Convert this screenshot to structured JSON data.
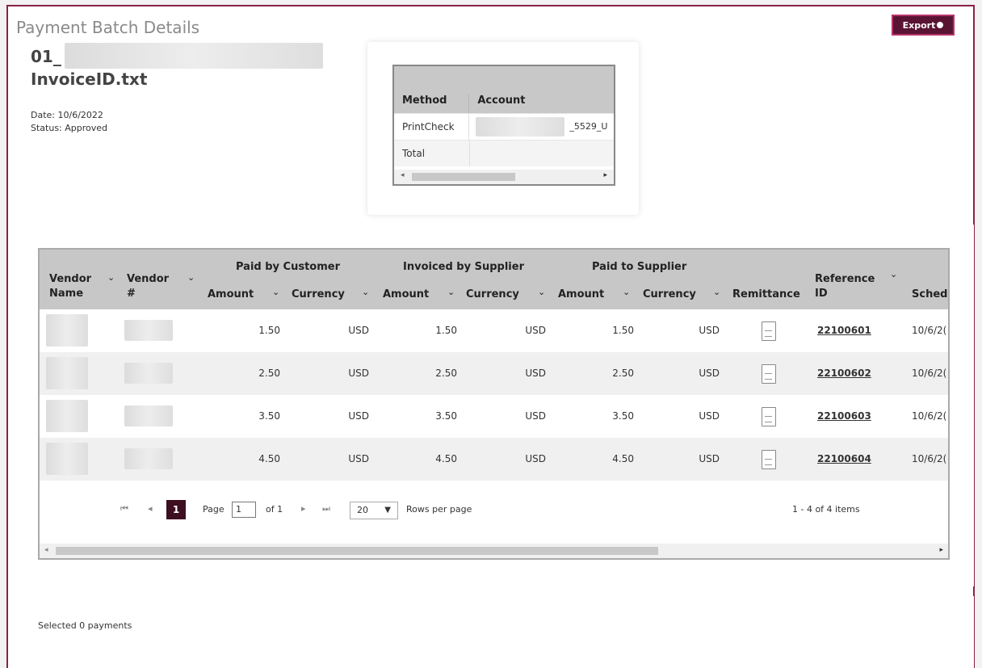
{
  "header": {
    "title": "Payment Batch Details",
    "file_prefix": "01_",
    "file_suffix": "InvoiceID.txt",
    "date": "Date: 10/6/2022",
    "status": "Status: Approved",
    "export_label": "Export"
  },
  "summary": {
    "columns": [
      "Method",
      "Account"
    ],
    "rows": [
      {
        "method": "PrintCheck",
        "account_suffix": "_5529_U"
      },
      {
        "method": "Total",
        "account_suffix": ""
      }
    ]
  },
  "grid": {
    "headers": {
      "vendor_name": "Vendor Name",
      "vendor_no": "Vendor #",
      "group_paid_by_customer": "Paid by Customer",
      "group_invoiced_by_supplier": "Invoiced by Supplier",
      "group_paid_to_supplier": "Paid to Supplier",
      "amount": "Amount",
      "currency": "Currency",
      "remittance": "Remittance",
      "reference_id": "Reference ID",
      "scheduled": "Sched"
    },
    "rows": [
      {
        "paid_amount": "1.50",
        "paid_currency": "USD",
        "inv_amount": "1.50",
        "inv_currency": "USD",
        "sup_amount": "1.50",
        "sup_currency": "USD",
        "ref": "22100601",
        "date": "10/6/2("
      },
      {
        "paid_amount": "2.50",
        "paid_currency": "USD",
        "inv_amount": "2.50",
        "inv_currency": "USD",
        "sup_amount": "2.50",
        "sup_currency": "USD",
        "ref": "22100602",
        "date": "10/6/2("
      },
      {
        "paid_amount": "3.50",
        "paid_currency": "USD",
        "inv_amount": "3.50",
        "inv_currency": "USD",
        "sup_amount": "3.50",
        "sup_currency": "USD",
        "ref": "22100603",
        "date": "10/6/2("
      },
      {
        "paid_amount": "4.50",
        "paid_currency": "USD",
        "inv_amount": "4.50",
        "inv_currency": "USD",
        "sup_amount": "4.50",
        "sup_currency": "USD",
        "ref": "22100604",
        "date": "10/6/2("
      }
    ],
    "pager": {
      "current_page": "1",
      "page_label": "Page",
      "page_input": "1",
      "of_label": "of 1",
      "rows_per_page_value": "20",
      "rows_per_page_label": "Rows per page",
      "items_summary": "1 - 4 of 4 items"
    }
  },
  "footer": {
    "selected_text": "Selected 0 payments"
  },
  "colors": {
    "brand": "#5a1433",
    "frame": "#8a2048",
    "header_bg": "#c7c7c7"
  },
  "icons": [
    "export-icon",
    "chevron-down-icon",
    "document-icon",
    "first-page-icon",
    "prev-page-icon",
    "next-page-icon",
    "last-page-icon",
    "dropdown-caret-icon"
  ]
}
